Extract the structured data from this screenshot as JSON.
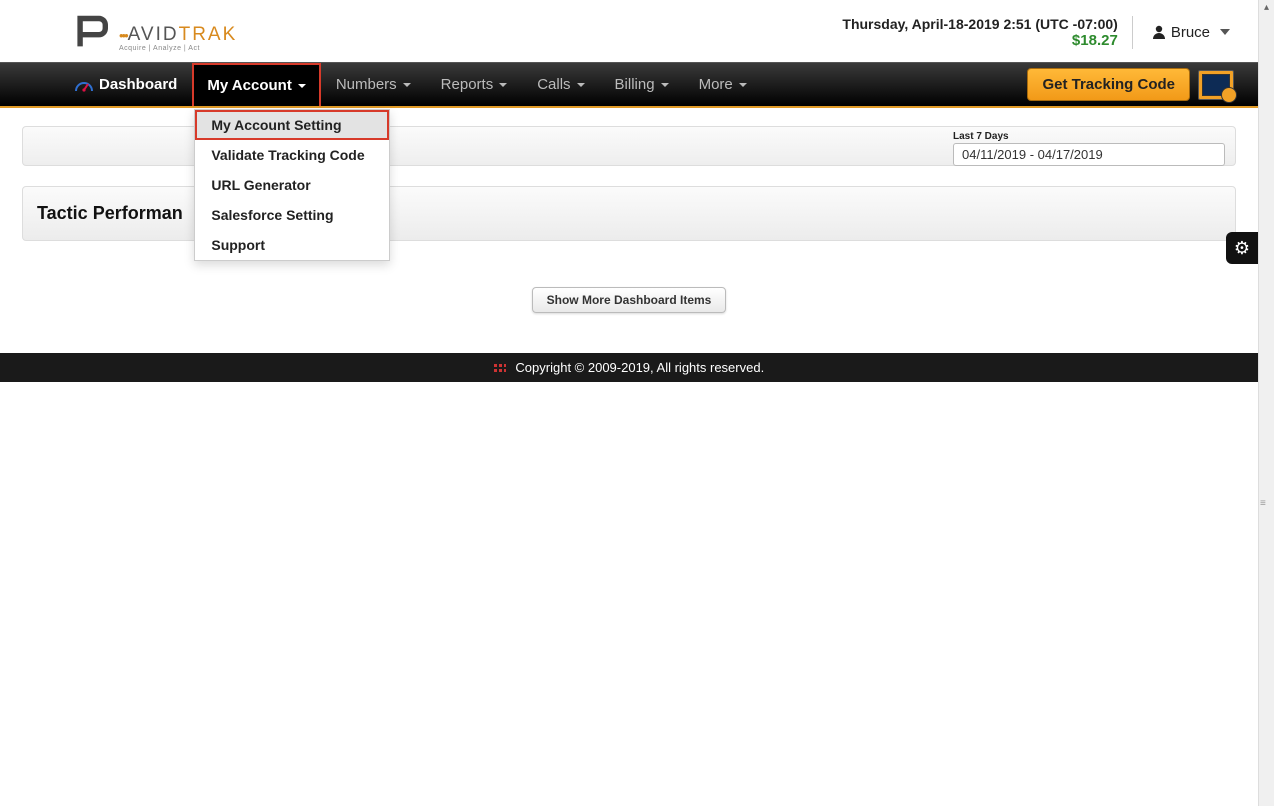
{
  "logo": {
    "brand_prefix": "AVID",
    "brand_suffix": "TRAK",
    "tagline": "Acquire  |  Analyze  |  Act"
  },
  "header": {
    "datetime": "Thursday, April-18-2019 2:51 (UTC -07:00)",
    "balance": "$18.27",
    "user_name": "Bruce"
  },
  "nav": {
    "dashboard": "Dashboard",
    "my_account": "My Account",
    "numbers": "Numbers",
    "reports": "Reports",
    "calls": "Calls",
    "billing": "Billing",
    "more": "More",
    "get_code": "Get Tracking Code"
  },
  "dropdown": {
    "items": [
      "My Account Setting",
      "Validate Tracking Code",
      "URL Generator",
      "Salesforce Setting",
      "Support"
    ]
  },
  "date_filter": {
    "label": "Last 7 Days",
    "value": "04/11/2019 - 04/17/2019"
  },
  "section": {
    "title": "Tactic Performan"
  },
  "buttons": {
    "show_more": "Show More Dashboard Items"
  },
  "footer": {
    "text": "Copyright © 2009-2019, All rights reserved."
  }
}
